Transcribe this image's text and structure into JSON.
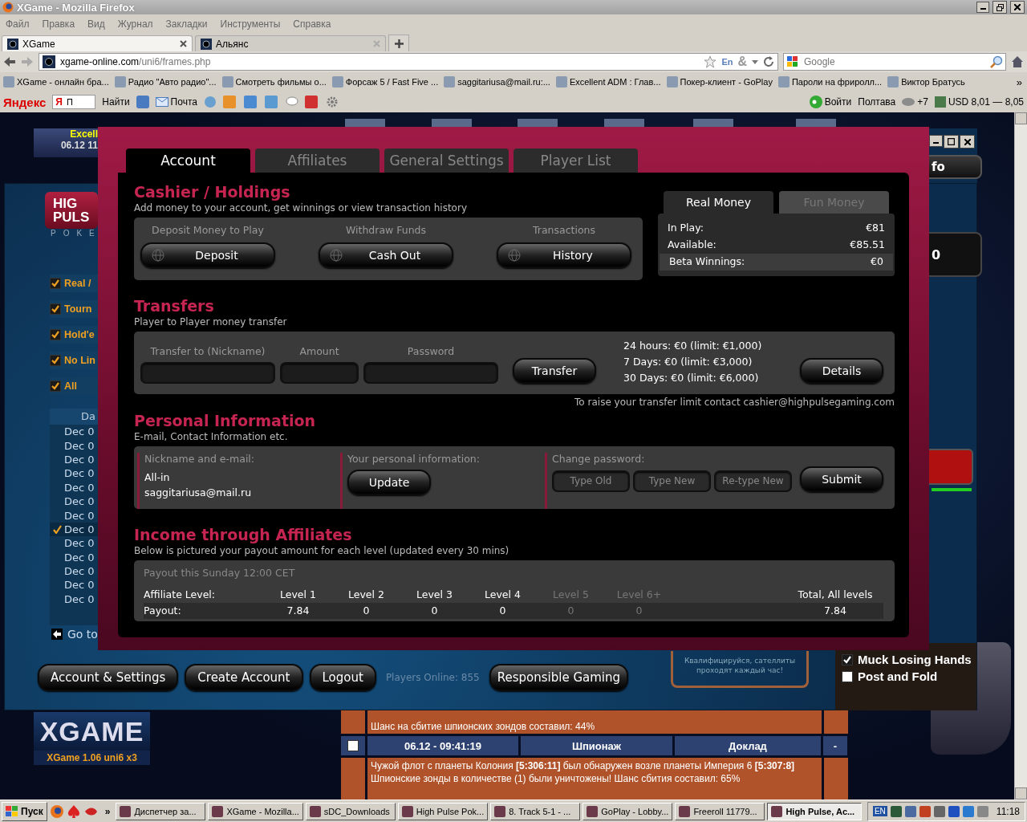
{
  "window": {
    "title": "XGame - Mozilla Firefox"
  },
  "menu": [
    "Файл",
    "Правка",
    "Вид",
    "Журнал",
    "Закладки",
    "Инструменты",
    "Справка"
  ],
  "tabs": [
    {
      "label": "XGame",
      "selected": true
    },
    {
      "label": "Альянс",
      "selected": false
    }
  ],
  "address": {
    "domain": "xgame-online.com",
    "path": "/uni6/frames.php",
    "translate_badge": "En",
    "extension_glyph": "&"
  },
  "search": {
    "placeholder": "Google"
  },
  "bookmarks": [
    "XGame - онлайн бра...",
    "Радио \"Авто радио\"...",
    "Смотреть фильмы о...",
    "Форсаж 5 / Fast Five ...",
    "saggitariusa@mail.ru:...",
    "Excellent ADM : Глав...",
    "Покер-клиент - GoPlay",
    "Пароли на фриролл...",
    "Виктор Братусь"
  ],
  "bookmarks_more": "»",
  "yandex_bar": {
    "logo": "Яндекс",
    "search_logo": "Я",
    "search_value": "П",
    "find": "Найти",
    "mail": "Почта",
    "login": "Войти",
    "city": "Полтава",
    "temperature": "+7",
    "currency": "USD 8,01 — 8,05"
  },
  "game_page": {
    "server_box": {
      "name": "Excell",
      "time": "06.12 11"
    },
    "logo": {
      "text": "XGAME",
      "version": "XGame 1.06 uni6 x3"
    },
    "messages": {
      "partial_text": "Шанс на сбитие шпионских зондов составил: 44%",
      "header": {
        "checked": false,
        "time": "06.12 - 09:41:19",
        "type": "Шпионаж",
        "report": "Доклад",
        "action": "-"
      },
      "body": "Чужой флот с планеты Колония **[5:306:11]** был обнаружен возле планеты Империя 6 **[5:307:8]** Шпионские зонды в количестве (1) были уничтожены! Шанс сбития составил: 65%"
    }
  },
  "poker_client": {
    "logo_lines": [
      "HIG",
      "PULS"
    ],
    "logo_sub": "POKE",
    "filters": [
      {
        "label": "Real /",
        "checked": true
      },
      {
        "label": "Tourn",
        "checked": true
      },
      {
        "label": "Hold'e",
        "checked": true
      },
      {
        "label": "No Lin",
        "checked": true
      },
      {
        "label": "All",
        "checked": true
      }
    ],
    "date_header": "Da",
    "dates": [
      {
        "label": "Dec 0",
        "checked": false
      },
      {
        "label": "Dec 0",
        "checked": false
      },
      {
        "label": "Dec 0",
        "checked": false
      },
      {
        "label": "Dec 0",
        "checked": false
      },
      {
        "label": "Dec 0",
        "checked": false
      },
      {
        "label": "Dec 0",
        "checked": false
      },
      {
        "label": "Dec 0",
        "checked": false
      },
      {
        "label": "Dec 0",
        "checked": true
      },
      {
        "label": "Dec 0",
        "checked": false
      },
      {
        "label": "Dec 0",
        "checked": false
      },
      {
        "label": "Dec 0",
        "checked": false
      },
      {
        "label": "Dec 0",
        "checked": false
      },
      {
        "label": "Dec 0",
        "checked": false
      }
    ],
    "go_to": "Go to",
    "right_tab": "fo",
    "right_value": "0",
    "bottom_buttons": [
      "Account & Settings",
      "Create Account",
      "Logout"
    ],
    "players_online": "Players Online: 855",
    "responsible_button": "Responsible Gaming",
    "banner_text": "Квалифицируйся, сателлиты проходят каждый час!",
    "options": [
      {
        "label": "Muck Losing Hands",
        "checked": true
      },
      {
        "label": "Post and Fold",
        "checked": false
      }
    ]
  },
  "account_dialog": {
    "tabs": [
      {
        "label": "Account",
        "selected": true
      },
      {
        "label": "Affiliates",
        "selected": false
      },
      {
        "label": "General Settings",
        "selected": false
      },
      {
        "label": "Player List",
        "selected": false
      }
    ],
    "cashier": {
      "title": "Cashier / Holdings",
      "subtitle": "Add money to your account, get winnings or view transaction history",
      "actions": [
        {
          "label": "Deposit Money to Play",
          "button": "Deposit"
        },
        {
          "label": "Withdraw Funds",
          "button": "Cash Out"
        },
        {
          "label": "Transactions",
          "button": "History"
        }
      ],
      "money_tabs": [
        {
          "label": "Real Money",
          "selected": true
        },
        {
          "label": "Fun Money",
          "selected": false
        }
      ],
      "balances": [
        {
          "label": "In Play:",
          "value": "€81"
        },
        {
          "label": "Available:",
          "value": "€85.51"
        },
        {
          "label": "Beta Winnings:",
          "value": "€0"
        }
      ]
    },
    "transfers": {
      "title": "Transfers",
      "subtitle": "Player to Player money transfer",
      "fields": [
        {
          "label": "Transfer to (Nickname)",
          "kind": "wide"
        },
        {
          "label": "Amount",
          "kind": "narrow"
        },
        {
          "label": "Password",
          "kind": "wide"
        }
      ],
      "transfer_button": "Transfer",
      "limits": [
        "24 hours: €0 (limit: €1,000)",
        "7 Days: €0 (limit: €3,000)",
        "30 Days: €0 (limit: €6,000)"
      ],
      "details_button": "Details",
      "note": "To raise your transfer limit contact cashier@highpulsegaming.com"
    },
    "personal": {
      "title": "Personal Information",
      "subtitle": "E-mail, Contact Information etc.",
      "nickname_label": "Nickname and e-mail:",
      "nickname": "All-in",
      "email": "saggitariusa@mail.ru",
      "info_label": "Your personal information:",
      "update_button": "Update",
      "password_label": "Change password:",
      "password_fields": [
        {
          "placeholder": "Type Old"
        },
        {
          "placeholder": "Type New"
        },
        {
          "placeholder": "Re-type New"
        }
      ],
      "submit_button": "Submit"
    },
    "affiliates": {
      "title": "Income through Affiliates",
      "subtitle": "Below is pictured your payout amount for each level (updated every 30 mins)",
      "payout_note": "Payout this Sunday 12:00 CET",
      "level_label": "Affiliate Level:",
      "payout_label": "Payout:",
      "levels": [
        {
          "label": "Level 1",
          "payout": "7.84",
          "disabled": false
        },
        {
          "label": "Level 2",
          "payout": "0",
          "disabled": false
        },
        {
          "label": "Level 3",
          "payout": "0",
          "disabled": false
        },
        {
          "label": "Level 4",
          "payout": "0",
          "disabled": false
        },
        {
          "label": "Level 5",
          "payout": "0",
          "disabled": true
        },
        {
          "label": "Level 6+",
          "payout": "0",
          "disabled": true
        }
      ],
      "total_label": "Total, All levels",
      "total": "7.84"
    }
  },
  "taskbar": {
    "start": "Пуск",
    "more": "»",
    "tasks": [
      {
        "label": "Диспетчер за...",
        "selected": false
      },
      {
        "label": "XGame - Mozilla...",
        "selected": false
      },
      {
        "label": "sDC_Downloads",
        "selected": false
      },
      {
        "label": "High Pulse Pok...",
        "selected": false
      },
      {
        "label": "8. Track  5-1 - ...",
        "selected": false
      },
      {
        "label": "GoPlay - Lobby...",
        "selected": false
      },
      {
        "label": "Freeroll 11779...",
        "selected": false
      },
      {
        "label": "High Pulse, Ac...",
        "selected": true
      }
    ],
    "language": "EN",
    "clock": "11:18"
  }
}
